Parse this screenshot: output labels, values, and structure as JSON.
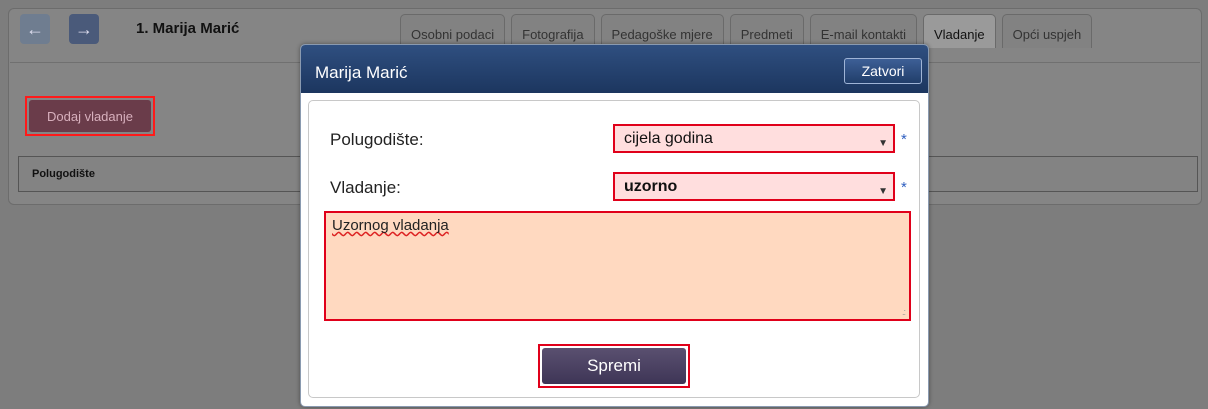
{
  "header": {
    "student_name": "1. Marija Marić"
  },
  "tabs": [
    {
      "label": "Osobni podaci"
    },
    {
      "label": "Fotografija"
    },
    {
      "label": "Pedagoške mjere"
    },
    {
      "label": "Predmeti"
    },
    {
      "label": "E-mail kontakti"
    },
    {
      "label": "Vladanje"
    },
    {
      "label": "Opći uspjeh"
    }
  ],
  "page": {
    "add_button": "Dodaj vladanje",
    "table_header": "Polugodište"
  },
  "dialog": {
    "title": "Marija Marić",
    "close_label": "Zatvori",
    "term_label": "Polugodište:",
    "term_value": "cijela godina",
    "conduct_label": "Vladanje:",
    "conduct_value": "uzorno",
    "required_mark": "*",
    "note_value": "Uzornog vladanja",
    "save_label": "Spremi"
  },
  "colors": {
    "highlight": "#e0001a",
    "title_bar": "#1c365f"
  },
  "icons": {
    "prev": "arrow-left-icon",
    "next": "arrow-right-icon",
    "dropdown": "chevron-down-icon"
  }
}
